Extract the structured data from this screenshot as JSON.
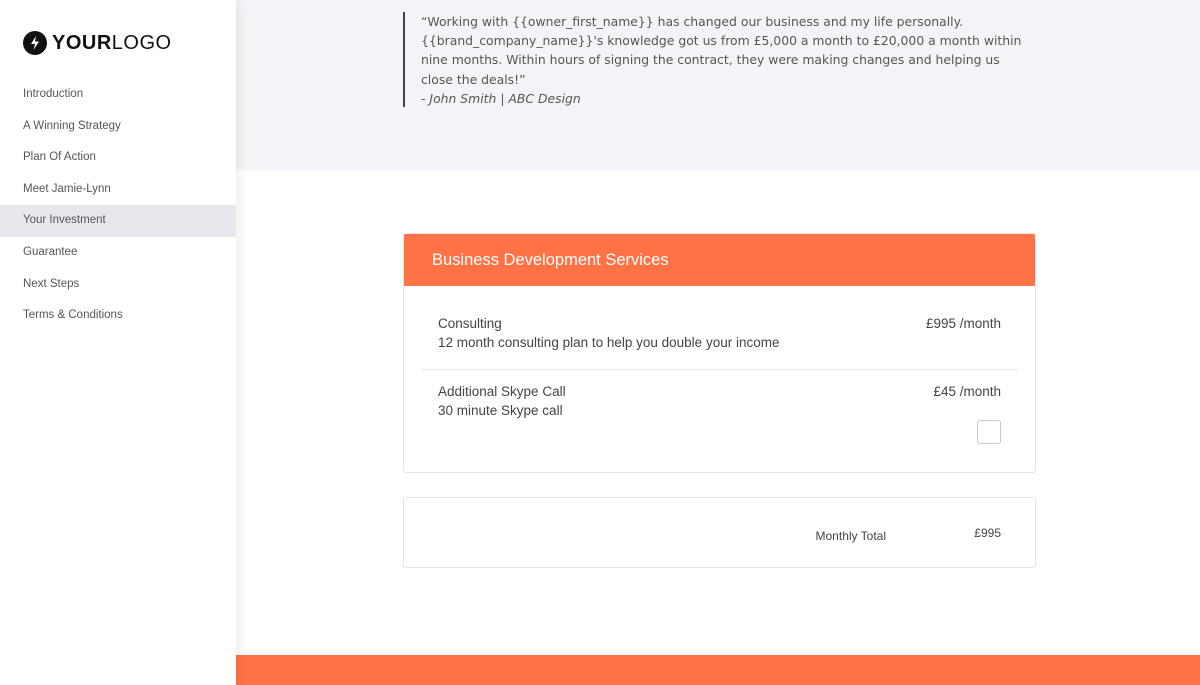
{
  "brand": {
    "logo_bold": "YOUR",
    "logo_light": "LOGO",
    "logo_icon": "lightning-bolt-icon",
    "accent_color": "#ff7245"
  },
  "sidebar": {
    "items": [
      {
        "label": "Introduction",
        "active": false
      },
      {
        "label": "A Winning Strategy",
        "active": false
      },
      {
        "label": "Plan Of Action",
        "active": false
      },
      {
        "label": "Meet Jamie-Lynn",
        "active": false
      },
      {
        "label": "Your Investment",
        "active": true
      },
      {
        "label": "Guarantee",
        "active": false
      },
      {
        "label": "Next Steps",
        "active": false
      },
      {
        "label": "Terms & Conditions",
        "active": false
      }
    ]
  },
  "testimonial": {
    "line1": "“Working with {{owner_first_name}} has changed our business and my life personally.",
    "line2": "{{brand_company_name}}'s knowledge got us from £5,000 a month to £20,000 a month within",
    "line3": "nine months. Within hours of signing the contract, they were making changes and helping us",
    "line4": "close the deals!”",
    "attribution": "- John Smith | ABC Design"
  },
  "pricing": {
    "header": "Business Development Services",
    "items": [
      {
        "title": "Consulting",
        "description": "12 month consulting plan to help you double your income",
        "price": "£995 /month"
      },
      {
        "title": "Additional Skype Call",
        "description": "30 minute Skype call",
        "price": "£45 /month",
        "selected": false
      }
    ],
    "total_label": "Monthly Total",
    "total_value": "£995"
  }
}
